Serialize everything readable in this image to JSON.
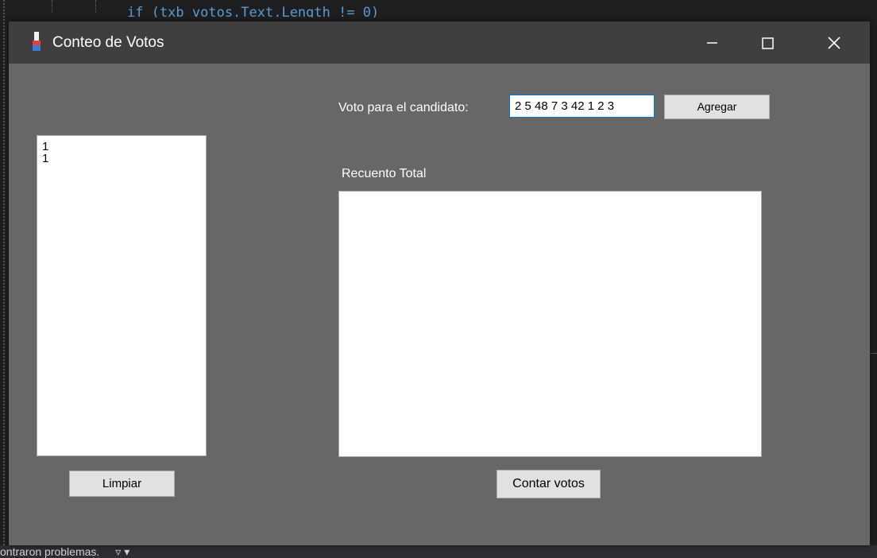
{
  "ide": {
    "code_line": "if (txb_votos.Text.Length != 0)",
    "status_text": "ontraron problemas."
  },
  "window": {
    "title": "Conteo de Votos"
  },
  "votes_list": {
    "items": [
      "1",
      "1"
    ]
  },
  "buttons": {
    "limpiar": "Limpiar",
    "agregar": "Agregar",
    "contar": "Contar votos"
  },
  "labels": {
    "voto": "Voto para el candidato:",
    "recuento": "Recuento Total"
  },
  "input": {
    "value": "2 5 48 7 3 42 1 2 3"
  },
  "colors": {
    "window_bg": "#676767",
    "titlebar_bg": "#3f3f3f",
    "focus_border": "#0078d7"
  }
}
